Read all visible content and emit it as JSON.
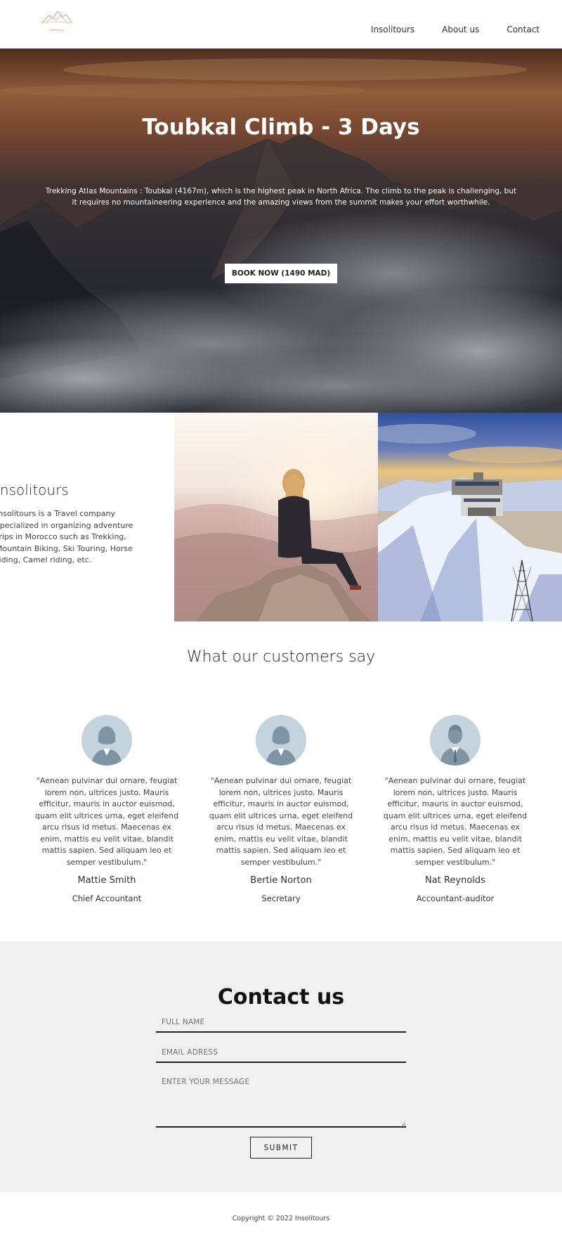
{
  "nav": {
    "logo_alt": "Insolitours",
    "links": [
      "Insolitours",
      "About us",
      "Contact"
    ]
  },
  "hero": {
    "title": "Toubkal Climb - 3 Days",
    "description": "Trekking Atlas Mountains : Toubkal (4167m), which is the highest peak in North Africa. The climb to the peak is challenging, but it requires no mountaineering experience and the amazing views from the summit makes your effort worthwhile.",
    "button_label": "BOOK NOW (1490 MAD)"
  },
  "about": {
    "title": "Insolitours",
    "text": "Insolitours is a Travel company specialized in organizing adventure trips in Morocco such as Trekking, Mountain Biking, Ski Touring, Horse riding, Camel riding, etc."
  },
  "testimonials": {
    "title": "What our customers say",
    "items": [
      {
        "quote": "\"Aenean pulvinar dui ornare, feugiat lorem non, ultrices justo. Mauris efficitur, mauris in auctor euismod, quam elit ultrices urna, eget eleifend arcu risus id metus. Maecenas ex enim, mattis eu velit vitae, blandit mattis sapien. Sed aliquam leo et semper vestibulum.\"",
        "name": "Mattie Smith",
        "role": "Chief Accountant",
        "avatar": "female-avatar-icon"
      },
      {
        "quote": "\"Aenean pulvinar dui ornare, feugiat lorem non, ultrices justo. Mauris efficitur, mauris in auctor euismod, quam elit ultrices urna, eget eleifend arcu risus id metus. Maecenas ex enim, mattis eu velit vitae, blandit mattis sapien. Sed aliquam leo et semper vestibulum.\"",
        "name": "Bertie Norton",
        "role": "Secretary",
        "avatar": "female-avatar-icon"
      },
      {
        "quote": "\"Aenean pulvinar dui ornare, feugiat lorem non, ultrices justo. Mauris efficitur, mauris in auctor euismod, quam elit ultrices urna, eget eleifend arcu risus id metus. Maecenas ex enim, mattis eu velit vitae, blandit mattis sapien. Sed aliquam leo et semper vestibulum.\"",
        "name": "Nat Reynolds",
        "role": "Accountant-auditor",
        "avatar": "male-avatar-icon"
      }
    ]
  },
  "contact": {
    "title": "Contact us",
    "name_placeholder": "FULL NAME",
    "email_placeholder": "EMAIL ADRESS",
    "message_placeholder": "ENTER YOUR MESSAGE",
    "submit_label": "SUBMIT"
  },
  "footer": {
    "copyright": "Copyright © 2022 Insolitours"
  },
  "colors": {
    "contact_bg": "#f1f1f1",
    "avatar_bg": "#c4d4de",
    "avatar_fg": "#7f95a5"
  }
}
